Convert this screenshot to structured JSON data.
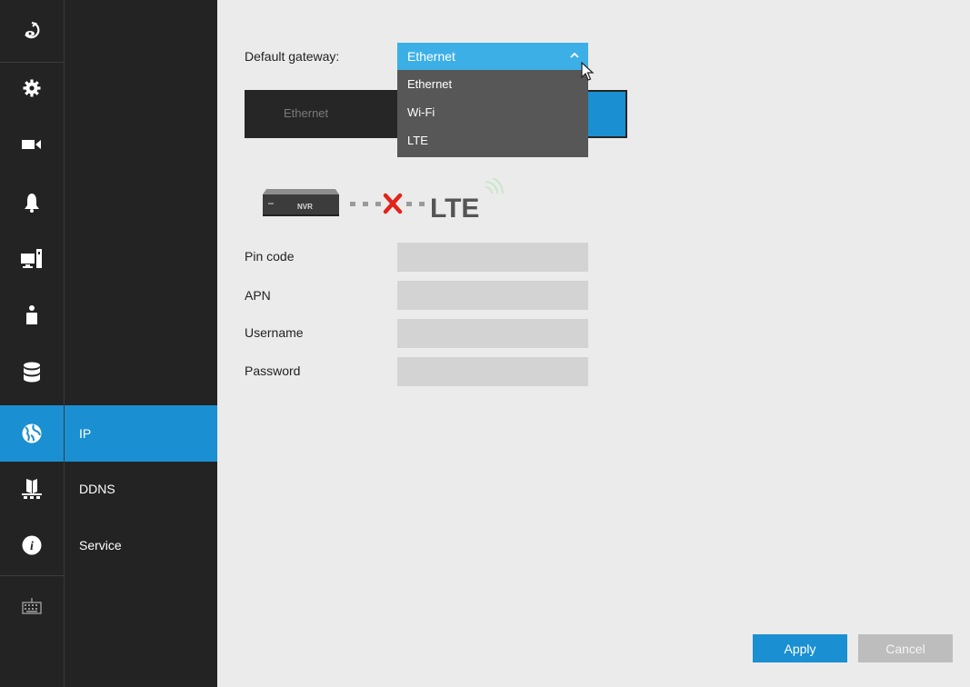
{
  "rail": {
    "icons": [
      "live-view-icon",
      "gear-icon",
      "camera-icon",
      "bell-icon",
      "monitor-icon",
      "user-icon",
      "database-icon",
      "globe-icon",
      "network-share-icon",
      "info-icon",
      "keyboard-icon"
    ],
    "active_index": 7
  },
  "submenu": {
    "items": [
      {
        "label": "IP",
        "active": true
      },
      {
        "label": "DDNS",
        "active": false
      },
      {
        "label": "Service",
        "active": false
      }
    ]
  },
  "gateway": {
    "label": "Default gateway:",
    "selected": "Ethernet",
    "options": [
      "Ethernet",
      "Wi-Fi",
      "LTE"
    ]
  },
  "netbar": {
    "tab_label": "Ethernet"
  },
  "diagram": {
    "device_label": "NVR",
    "network_label": "LTE",
    "status": "disconnected"
  },
  "form": {
    "fields": [
      {
        "label": "Pin code",
        "value": ""
      },
      {
        "label": "APN",
        "value": ""
      },
      {
        "label": "Username",
        "value": ""
      },
      {
        "label": "Password",
        "value": ""
      }
    ]
  },
  "actions": {
    "apply": "Apply",
    "cancel": "Cancel"
  },
  "colors": {
    "accent": "#1a8fd2",
    "select": "#3cb0e6",
    "sidebar": "#232323",
    "background": "#ebebeb",
    "error": "#e2231a"
  }
}
